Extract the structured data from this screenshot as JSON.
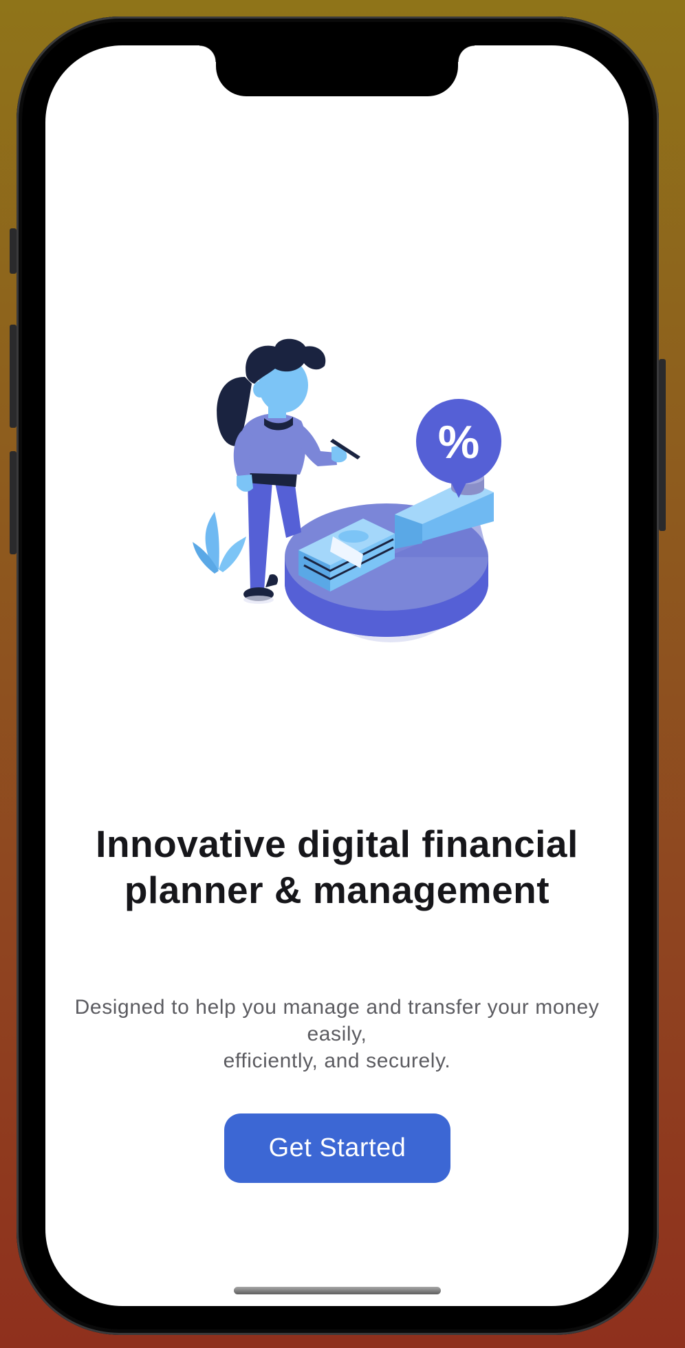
{
  "onboarding": {
    "illustration": {
      "description_icon": "woman-with-pie-chart-icon",
      "percent_symbol": "%"
    },
    "headline": "Innovative digital financial planner & management",
    "subtitle": "Designed to help you manage and transfer your money easily,\nefficiently, and securely.",
    "cta_label": "Get Started"
  },
  "colors": {
    "accent": "#3c67d4",
    "illustration_primary": "#5560d6",
    "illustration_light": "#7b86d8",
    "illustration_sky": "#7cc4f6",
    "illustration_dark": "#1a2340",
    "headline_text": "#16161a",
    "subtitle_text": "#5b5b60"
  }
}
